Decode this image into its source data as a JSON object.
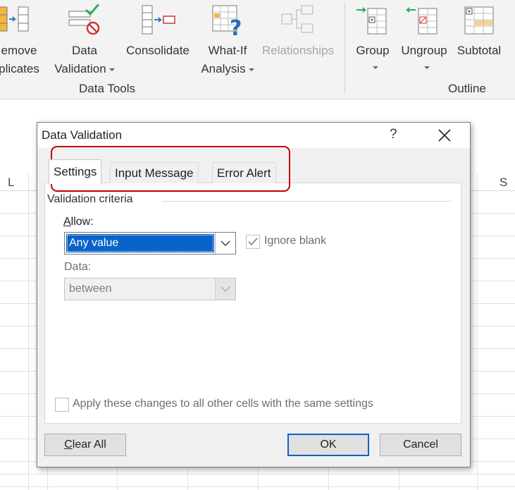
{
  "ribbon": {
    "remove_duplicates": {
      "line1": "emove",
      "line2": "plicates"
    },
    "data_validation": {
      "line1": "Data",
      "line2": "Validation"
    },
    "consolidate": {
      "line1": "Consolidate"
    },
    "what_if": {
      "line1": "What-If",
      "line2": "Analysis"
    },
    "relationships": {
      "line1": "Relationships"
    },
    "group": {
      "line1": "Group"
    },
    "ungroup": {
      "line1": "Ungroup"
    },
    "subtotal": {
      "line1": "Subtotal"
    },
    "group_labels": {
      "data_tools": "Data Tools",
      "outline": "Outline"
    }
  },
  "sheet": {
    "column_letters": {
      "left": "L",
      "right": "S"
    }
  },
  "dialog": {
    "title": "Data Validation",
    "help": "?",
    "tabs": [
      "Settings",
      "Input Message",
      "Error Alert"
    ],
    "active_tab": "Settings",
    "section": "Validation criteria",
    "allow_label_u": "A",
    "allow_label_rest": "llow:",
    "allow_value": "Any value",
    "ignore_blank_label": "Ignore blank",
    "ignore_blank_checked": true,
    "data_label": "Data:",
    "data_value": "between",
    "apply_label": "Apply these changes to all other cells with the same settings",
    "buttons": {
      "clear_all_u": "C",
      "clear_all_rest": "lear All",
      "ok": "OK",
      "cancel": "Cancel"
    }
  },
  "colors": {
    "accent": "#0a63c9",
    "highlight": "#c00000"
  }
}
